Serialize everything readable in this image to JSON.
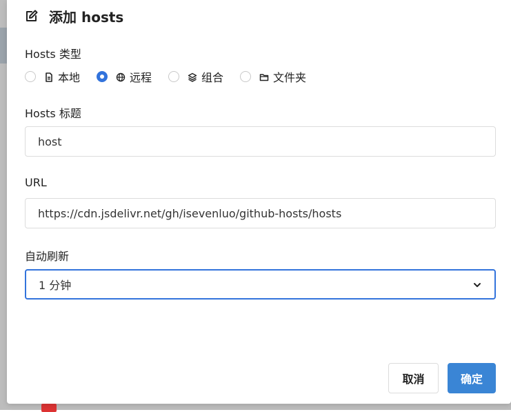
{
  "dialog": {
    "title": "添加 hosts",
    "title_icon": "edit-icon"
  },
  "hosts_type": {
    "label": "Hosts 类型",
    "options": [
      {
        "label": "本地",
        "icon": "file-icon",
        "checked": false
      },
      {
        "label": "远程",
        "icon": "globe-icon",
        "checked": true
      },
      {
        "label": "组合",
        "icon": "layers-icon",
        "checked": false
      },
      {
        "label": "文件夹",
        "icon": "folder-icon",
        "checked": false
      }
    ]
  },
  "hosts_title": {
    "label": "Hosts 标题",
    "value": "host"
  },
  "url": {
    "label": "URL",
    "value": "https://cdn.jsdelivr.net/gh/isevenluo/github-hosts/hosts"
  },
  "auto_refresh": {
    "label": "自动刷新",
    "selected": "1 分钟"
  },
  "buttons": {
    "cancel": "取消",
    "ok": "确定"
  },
  "colors": {
    "accent": "#3273dc",
    "primary_button": "#3a85d5",
    "backdrop": "#bdbdbd"
  }
}
